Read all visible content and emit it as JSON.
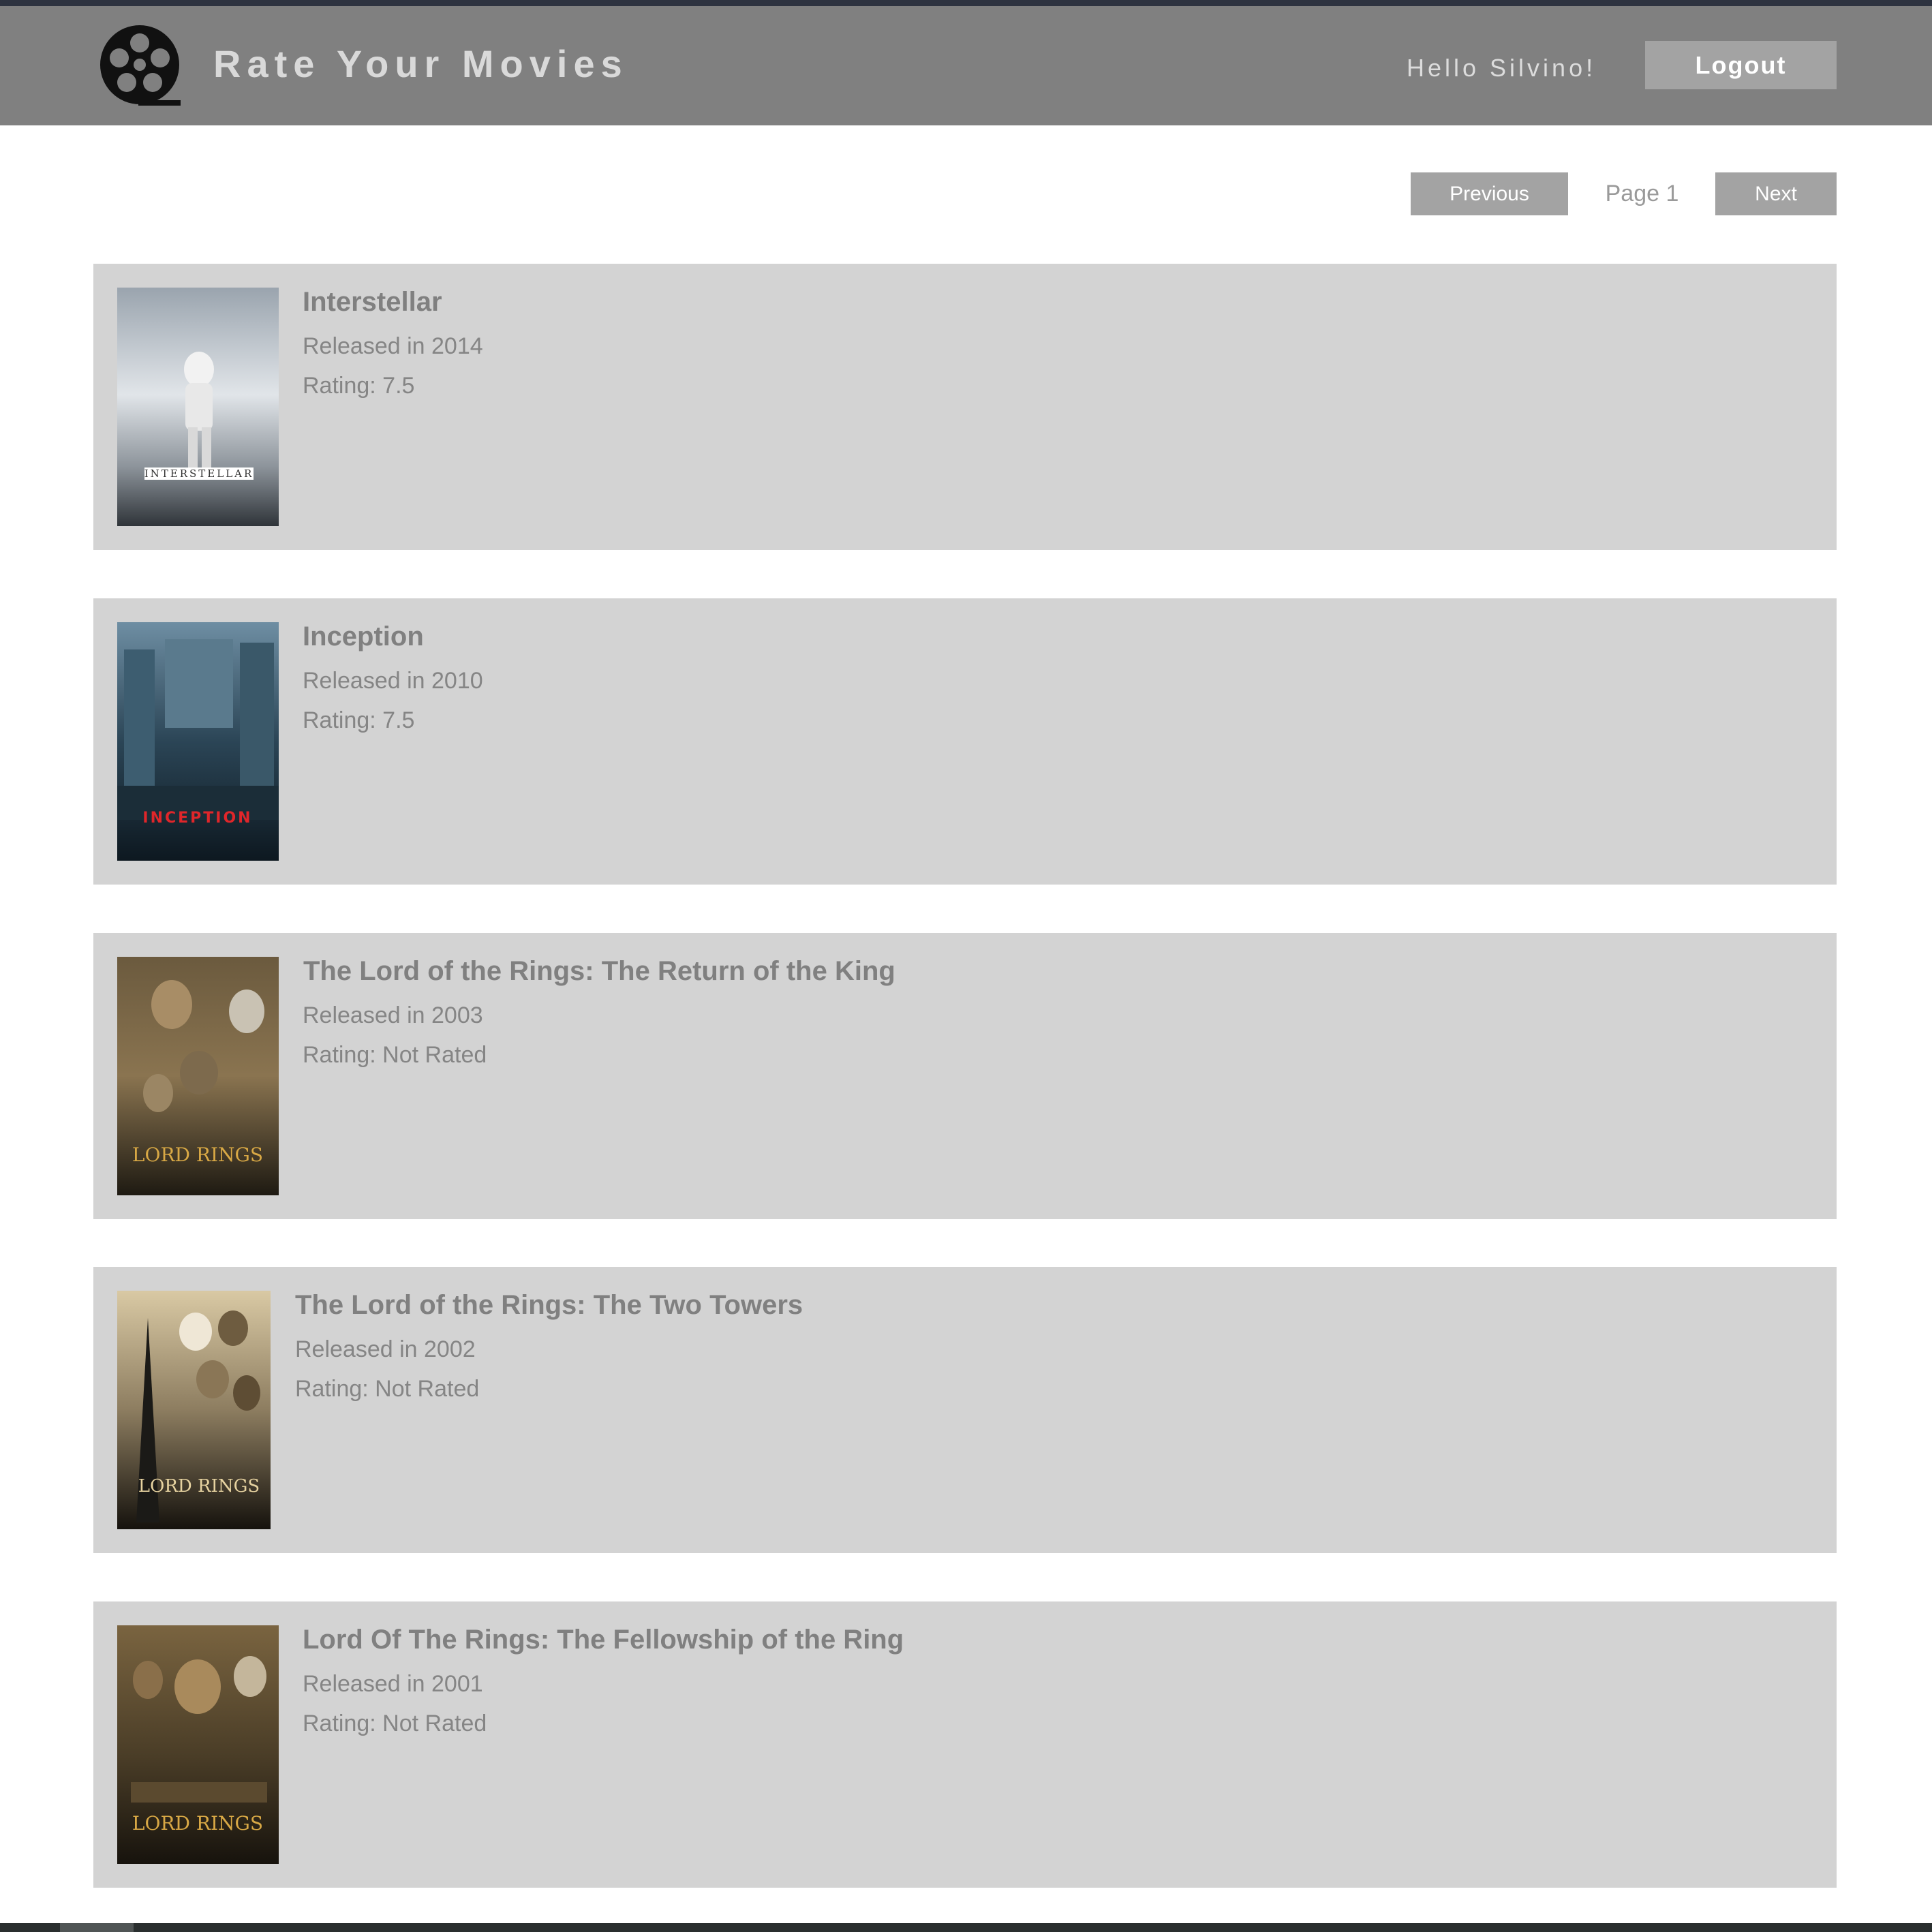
{
  "header": {
    "logo_icon": "film-reel-icon",
    "title": "Rate Your Movies",
    "greeting": "Hello Silvino!",
    "logout_label": "Logout"
  },
  "pagination": {
    "previous_label": "Previous",
    "page_label": "Page 1",
    "next_label": "Next"
  },
  "movies": [
    {
      "title": "Interstellar",
      "released": "Released in 2014",
      "rating": "Rating: 7.5",
      "poster_text": "INTERSTELLAR"
    },
    {
      "title": "Inception",
      "released": "Released in 2010",
      "rating": "Rating: 7.5",
      "poster_text": "INCEPTION"
    },
    {
      "title": "The Lord of the Rings: The Return of the King",
      "released": "Released in 2003",
      "rating": "Rating: Not Rated",
      "poster_text": "LORD RINGS"
    },
    {
      "title": "The Lord of the Rings: The Two Towers",
      "released": "Released in 2002",
      "rating": "Rating: Not Rated",
      "poster_text": "LORD RINGS"
    },
    {
      "title": "Lord Of The Rings: The Fellowship of the Ring",
      "released": "Released in 2001",
      "rating": "Rating: Not Rated",
      "poster_text": "LORD RINGS"
    }
  ],
  "colors": {
    "header_bg": "#808080",
    "card_bg": "#d3d3d3",
    "button_bg": "#a3a3a3",
    "text_muted": "#858585"
  }
}
